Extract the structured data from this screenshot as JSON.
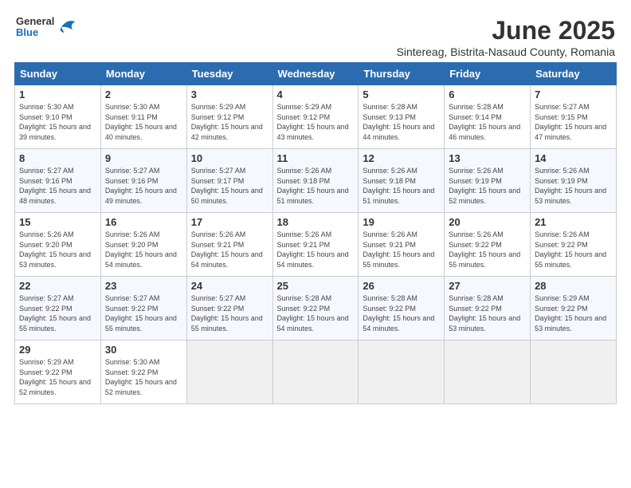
{
  "header": {
    "logo": {
      "general": "General",
      "blue": "Blue"
    },
    "title": "June 2025",
    "subtitle": "Sintereag, Bistrita-Nasaud County, Romania"
  },
  "calendar": {
    "columns": [
      "Sunday",
      "Monday",
      "Tuesday",
      "Wednesday",
      "Thursday",
      "Friday",
      "Saturday"
    ],
    "weeks": [
      [
        null,
        {
          "day": 2,
          "sunrise": "5:30 AM",
          "sunset": "9:11 PM",
          "daylight": "15 hours and 40 minutes."
        },
        {
          "day": 3,
          "sunrise": "5:29 AM",
          "sunset": "9:12 PM",
          "daylight": "15 hours and 42 minutes."
        },
        {
          "day": 4,
          "sunrise": "5:29 AM",
          "sunset": "9:12 PM",
          "daylight": "15 hours and 43 minutes."
        },
        {
          "day": 5,
          "sunrise": "5:28 AM",
          "sunset": "9:13 PM",
          "daylight": "15 hours and 44 minutes."
        },
        {
          "day": 6,
          "sunrise": "5:28 AM",
          "sunset": "9:14 PM",
          "daylight": "15 hours and 46 minutes."
        },
        {
          "day": 7,
          "sunrise": "5:27 AM",
          "sunset": "9:15 PM",
          "daylight": "15 hours and 47 minutes."
        }
      ],
      [
        {
          "day": 8,
          "sunrise": "5:27 AM",
          "sunset": "9:16 PM",
          "daylight": "15 hours and 48 minutes."
        },
        {
          "day": 9,
          "sunrise": "5:27 AM",
          "sunset": "9:16 PM",
          "daylight": "15 hours and 49 minutes."
        },
        {
          "day": 10,
          "sunrise": "5:27 AM",
          "sunset": "9:17 PM",
          "daylight": "15 hours and 50 minutes."
        },
        {
          "day": 11,
          "sunrise": "5:26 AM",
          "sunset": "9:18 PM",
          "daylight": "15 hours and 51 minutes."
        },
        {
          "day": 12,
          "sunrise": "5:26 AM",
          "sunset": "9:18 PM",
          "daylight": "15 hours and 51 minutes."
        },
        {
          "day": 13,
          "sunrise": "5:26 AM",
          "sunset": "9:19 PM",
          "daylight": "15 hours and 52 minutes."
        },
        {
          "day": 14,
          "sunrise": "5:26 AM",
          "sunset": "9:19 PM",
          "daylight": "15 hours and 53 minutes."
        }
      ],
      [
        {
          "day": 15,
          "sunrise": "5:26 AM",
          "sunset": "9:20 PM",
          "daylight": "15 hours and 53 minutes."
        },
        {
          "day": 16,
          "sunrise": "5:26 AM",
          "sunset": "9:20 PM",
          "daylight": "15 hours and 54 minutes."
        },
        {
          "day": 17,
          "sunrise": "5:26 AM",
          "sunset": "9:21 PM",
          "daylight": "15 hours and 54 minutes."
        },
        {
          "day": 18,
          "sunrise": "5:26 AM",
          "sunset": "9:21 PM",
          "daylight": "15 hours and 54 minutes."
        },
        {
          "day": 19,
          "sunrise": "5:26 AM",
          "sunset": "9:21 PM",
          "daylight": "15 hours and 55 minutes."
        },
        {
          "day": 20,
          "sunrise": "5:26 AM",
          "sunset": "9:22 PM",
          "daylight": "15 hours and 55 minutes."
        },
        {
          "day": 21,
          "sunrise": "5:26 AM",
          "sunset": "9:22 PM",
          "daylight": "15 hours and 55 minutes."
        }
      ],
      [
        {
          "day": 22,
          "sunrise": "5:27 AM",
          "sunset": "9:22 PM",
          "daylight": "15 hours and 55 minutes."
        },
        {
          "day": 23,
          "sunrise": "5:27 AM",
          "sunset": "9:22 PM",
          "daylight": "15 hours and 55 minutes."
        },
        {
          "day": 24,
          "sunrise": "5:27 AM",
          "sunset": "9:22 PM",
          "daylight": "15 hours and 55 minutes."
        },
        {
          "day": 25,
          "sunrise": "5:28 AM",
          "sunset": "9:22 PM",
          "daylight": "15 hours and 54 minutes."
        },
        {
          "day": 26,
          "sunrise": "5:28 AM",
          "sunset": "9:22 PM",
          "daylight": "15 hours and 54 minutes."
        },
        {
          "day": 27,
          "sunrise": "5:28 AM",
          "sunset": "9:22 PM",
          "daylight": "15 hours and 53 minutes."
        },
        {
          "day": 28,
          "sunrise": "5:29 AM",
          "sunset": "9:22 PM",
          "daylight": "15 hours and 53 minutes."
        }
      ],
      [
        {
          "day": 29,
          "sunrise": "5:29 AM",
          "sunset": "9:22 PM",
          "daylight": "15 hours and 52 minutes."
        },
        {
          "day": 30,
          "sunrise": "5:30 AM",
          "sunset": "9:22 PM",
          "daylight": "15 hours and 52 minutes."
        },
        null,
        null,
        null,
        null,
        null
      ]
    ],
    "week1_day1": {
      "day": 1,
      "sunrise": "5:30 AM",
      "sunset": "9:10 PM",
      "daylight": "15 hours and 39 minutes."
    }
  }
}
